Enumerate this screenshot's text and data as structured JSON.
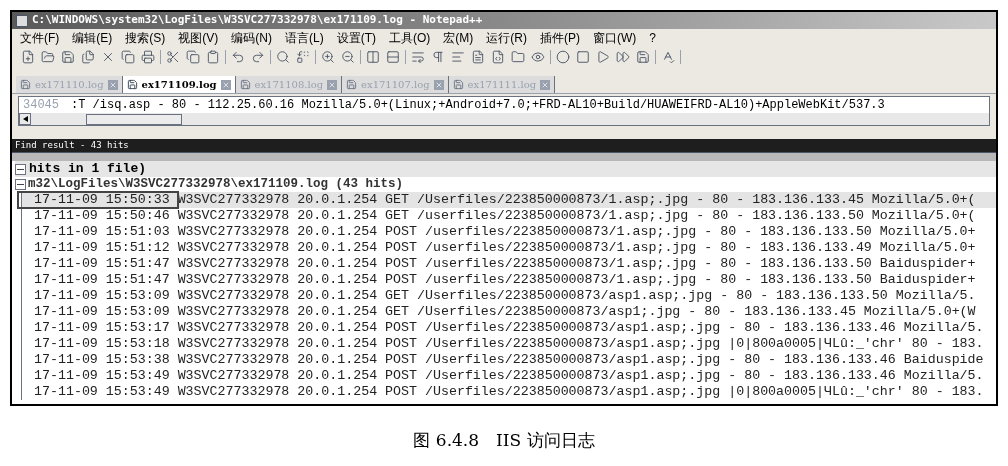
{
  "window": {
    "title": "C:\\WINDOWS\\system32\\LogFiles\\W3SVC277332978\\ex171109.log - Notepad++"
  },
  "menu": [
    "文件(F)",
    "编辑(E)",
    "搜索(S)",
    "视图(V)",
    "编码(N)",
    "语言(L)",
    "设置(T)",
    "工具(O)",
    "宏(M)",
    "运行(R)",
    "插件(P)",
    "窗口(W)",
    "?"
  ],
  "tabs": [
    {
      "label": "ex171110.log",
      "selected": false
    },
    {
      "label": "ex171109.log",
      "selected": true
    },
    {
      "label": "ex171108.log",
      "selected": false
    },
    {
      "label": "ex171107.log",
      "selected": false
    },
    {
      "label": "ex171111.log",
      "selected": false
    }
  ],
  "editor": {
    "line_number": "34045",
    "text": ":T /isq.asp - 80 - 112.25.60.16 Mozilla/5.0+(Linux;+Android+7.0;+FRD-AL10+Build/HUAWEIFRD-AL10)+AppleWebKit/537.3"
  },
  "find_result": {
    "title": "Find result - 43 hits",
    "summary": "hits in 1 file)",
    "summary_expanded": true,
    "file": "m32\\LogFiles\\W3SVC277332978\\ex171109.log (43 hits)",
    "file_expanded": true,
    "rows": [
      {
        "text": "17-11-09 15:50:33 W3SVC277332978 20.0.1.254 GET /Userfiles/223850000873/1.asp;.jpg - 80 - 183.136.133.45 Mozilla/5.0+(",
        "selected": true
      },
      {
        "text": "17-11-09 15:50:46 W3SVC277332978 20.0.1.254 GET /userfiles/223850000873/1.asp;.jpg - 80 - 183.136.133.50 Mozilla/5.0+(",
        "selected": false
      },
      {
        "text": "17-11-09 15:51:03 W3SVC277332978 20.0.1.254 POST /userfiles/223850000873/1.asp;.jpg - 80 - 183.136.133.50 Mozilla/5.0+",
        "selected": false
      },
      {
        "text": "17-11-09 15:51:12 W3SVC277332978 20.0.1.254 POST /userfiles/223850000873/1.asp;.jpg - 80 - 183.136.133.49 Mozilla/5.0+",
        "selected": false
      },
      {
        "text": "17-11-09 15:51:47 W3SVC277332978 20.0.1.254 POST /userfiles/223850000873/1.asp;.jpg - 80 - 183.136.133.50 Baiduspider+",
        "selected": false
      },
      {
        "text": "17-11-09 15:51:47 W3SVC277332978 20.0.1.254 POST /userfiles/223850000873/1.asp;.jpg - 80 - 183.136.133.50 Baiduspider+",
        "selected": false
      },
      {
        "text": "17-11-09 15:53:09 W3SVC277332978 20.0.1.254 GET /Userfiles/223850000873/asp1.asp;.jpg - 80 - 183.136.133.50 Mozilla/5.",
        "selected": false
      },
      {
        "text": "17-11-09 15:53:09 W3SVC277332978 20.0.1.254 GET /Userfiles/223850000873/asp1;.jpg - 80 - 183.136.133.45 Mozilla/5.0+(W",
        "selected": false
      },
      {
        "text": "17-11-09 15:53:17 W3SVC277332978 20.0.1.254 POST /Userfiles/223850000873/asp1.asp;.jpg - 80 - 183.136.133.46 Mozilla/5.",
        "selected": false
      },
      {
        "text": "17-11-09 15:53:18 W3SVC277332978 20.0.1.254 POST /Userfiles/223850000873/asp1.asp;.jpg |0|800a0005|ЧLû:_'chr' 80 - 183.",
        "selected": false
      },
      {
        "text": "17-11-09 15:53:38 W3SVC277332978 20.0.1.254 POST /Userfiles/223850000873/asp1.asp;.jpg - 80 - 183.136.133.46 Baiduspide",
        "selected": false
      },
      {
        "text": "17-11-09 15:53:49 W3SVC277332978 20.0.1.254 POST /Userfiles/223850000873/asp1.asp;.jpg - 80 - 183.136.133.46 Mozilla/5.",
        "selected": false
      },
      {
        "text": "17-11-09 15:53:49 W3SVC277332978 20.0.1.254 POST /Userfiles/223850000873/asp1.asp;.jpg |0|800a0005|ЧLû:_'chr' 80 - 183.",
        "selected": false
      }
    ]
  },
  "caption": "图 6.4.8　IIS 访问日志"
}
